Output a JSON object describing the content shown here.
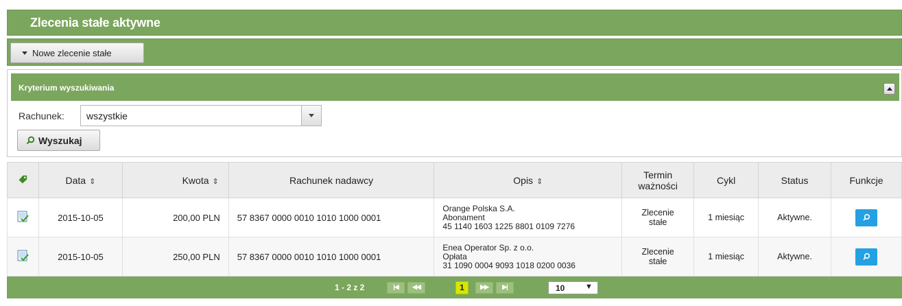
{
  "page": {
    "title": "Zlecenia stałe aktywne",
    "new_order_button": "Nowe zlecenie stałe"
  },
  "criteria": {
    "title": "Kryterium wyszukiwania",
    "account_label": "Rachunek:",
    "account_value": "wszystkie",
    "search_button": "Wyszukaj"
  },
  "table": {
    "headers": {
      "date": "Data",
      "amount": "Kwota",
      "sender_account": "Rachunek nadawcy",
      "description": "Opis",
      "validity_line1": "Termin",
      "validity_line2": "ważności",
      "cycle": "Cykl",
      "status": "Status",
      "functions": "Funkcje"
    },
    "rows": [
      {
        "date": "2015-10-05",
        "amount": "200,00 PLN",
        "sender_account": "57 8367 0000 0010 1010 1000 0001",
        "desc_line1": "Orange Polska S.A.",
        "desc_line2": "Abonament",
        "desc_line3": "45 1140 1603 1225 8801 0109 7276",
        "validity_line1": "Zlecenie",
        "validity_line2": "stałe",
        "cycle": "1 miesiąc",
        "status": "Aktywne."
      },
      {
        "date": "2015-10-05",
        "amount": "250,00 PLN",
        "sender_account": "57 8367 0000 0010 1010 1000 0001",
        "desc_line1": "Enea Operator Sp. z o.o.",
        "desc_line2": "Opłata",
        "desc_line3": "31 1090 0004 9093 1018 0200 0036",
        "validity_line1": "Zlecenie",
        "validity_line2": "stałe",
        "cycle": "1 miesiąc",
        "status": "Aktywne."
      }
    ]
  },
  "pagination": {
    "info": "1 - 2 z 2",
    "current_page": "1",
    "page_size": "10",
    "first_icon": "first-page-icon",
    "prev_icon": "previous-page-icon",
    "next_icon": "next-page-icon",
    "last_icon": "last-page-icon"
  },
  "colors": {
    "header_green": "#7ba65d",
    "function_button_blue": "#25a0e3",
    "current_page_yellow": "#d6e800"
  }
}
